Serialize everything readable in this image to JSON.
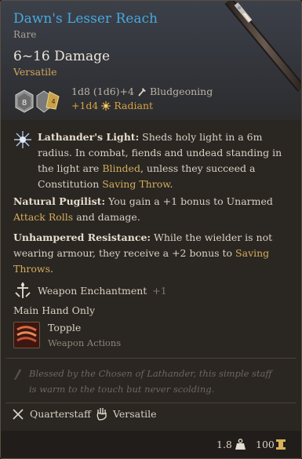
{
  "item": {
    "name": "Dawn's Lesser Reach",
    "rarity": "Rare",
    "damage_range": "6~16 Damage",
    "damage_property": "Versatile",
    "damage_roll": "1d8 (1d6)+4",
    "damage_type": "Bludgeoning",
    "bonus_roll": "+1d4",
    "bonus_type": "Radiant"
  },
  "abilities": [
    {
      "title": "Lathander's Light:",
      "text_a": "Sheds holy light in a 6m radius. In combat, fiends and undead standing in the light are",
      "keyword_a": "Blinded",
      "text_b": ", unless they succeed a Constitution",
      "keyword_b": "Saving Throw",
      "text_c": "."
    },
    {
      "title": "Natural Pugilist:",
      "text_a": "You gain a +1 bonus to Unarmed",
      "keyword_a": "Attack Rolls",
      "text_b": "and damage."
    },
    {
      "title": "Unhampered Resistance:",
      "text_a": "While the wielder is not wearing armour, they receive a +2 bonus to",
      "keyword_a": "Saving Throws",
      "text_b": "."
    }
  ],
  "enchantment": {
    "label": "Weapon Enchantment",
    "value": "+1"
  },
  "hand": "Main Hand Only",
  "action": {
    "name": "Topple",
    "category": "Weapon Actions"
  },
  "lore": "Blessed by the Chosen of Lathander, this simple staff is warm to the touch but never scolding.",
  "tags": [
    {
      "label": "Quarterstaff",
      "icon": "crossed-staves-icon"
    },
    {
      "label": "Versatile",
      "icon": "open-hand-icon"
    }
  ],
  "footer": {
    "weight": "1.8",
    "weight_icon": "weight-icon",
    "value": "100",
    "value_icon": "gold-coin-icon"
  },
  "colors": {
    "title": "#48a9de",
    "gold": "#d3ad5c",
    "radiant": "#d8a340",
    "text": "#d9d1c4",
    "muted": "#7f776c",
    "panel": "#2a2622"
  }
}
